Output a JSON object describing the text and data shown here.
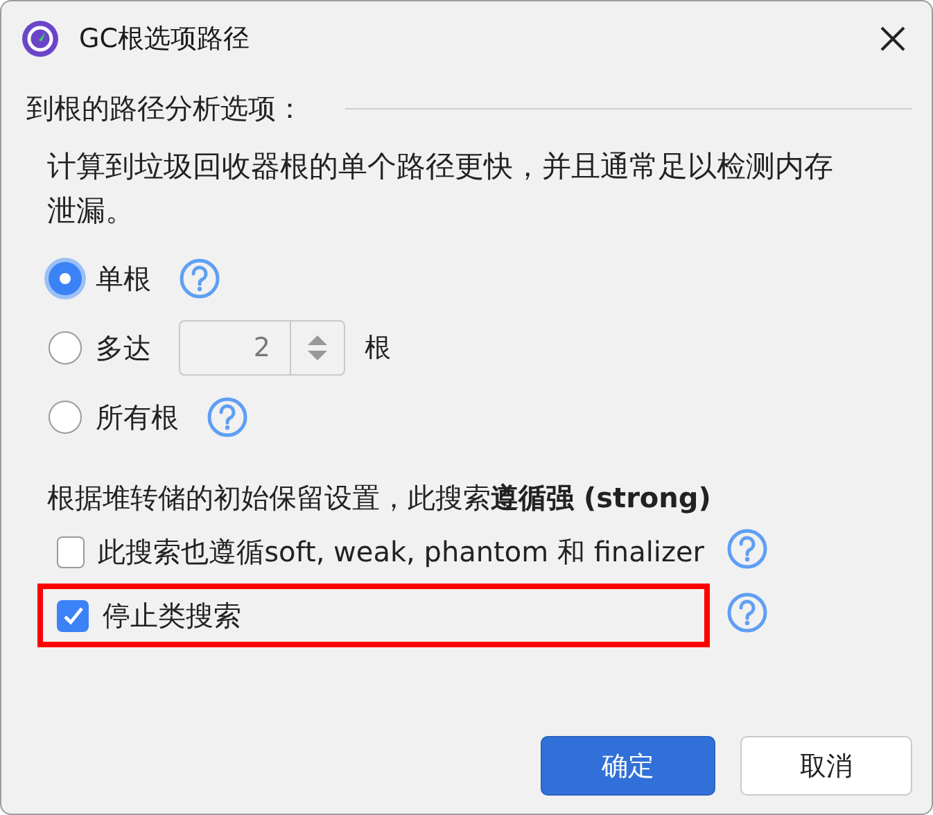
{
  "window": {
    "title": "GC根选项路径"
  },
  "section": {
    "heading": "到根的路径分析选项：",
    "description": "计算到垃圾回收器根的单个路径更快，并且通常足以检测内存泄漏。"
  },
  "radios": [
    {
      "label": "单根",
      "selected": true,
      "help": true
    },
    {
      "label": "多达",
      "selected": false,
      "help": false,
      "spinner": {
        "value": "2",
        "unit": "根"
      }
    },
    {
      "label": "所有根",
      "selected": false,
      "help": true
    }
  ],
  "note": "根据堆转储的初始保留设置，此搜索**遵循强 (strong)**",
  "checkboxes": [
    {
      "label": "此搜索也遵循soft, weak, phantom 和 finalizer",
      "checked": false,
      "highlighted": false
    },
    {
      "label": "停止类搜索",
      "checked": true,
      "highlighted": true
    }
  ],
  "buttons": [
    {
      "label": "确定",
      "kind": "primary"
    },
    {
      "label": "取消",
      "kind": "secondary"
    }
  ]
}
